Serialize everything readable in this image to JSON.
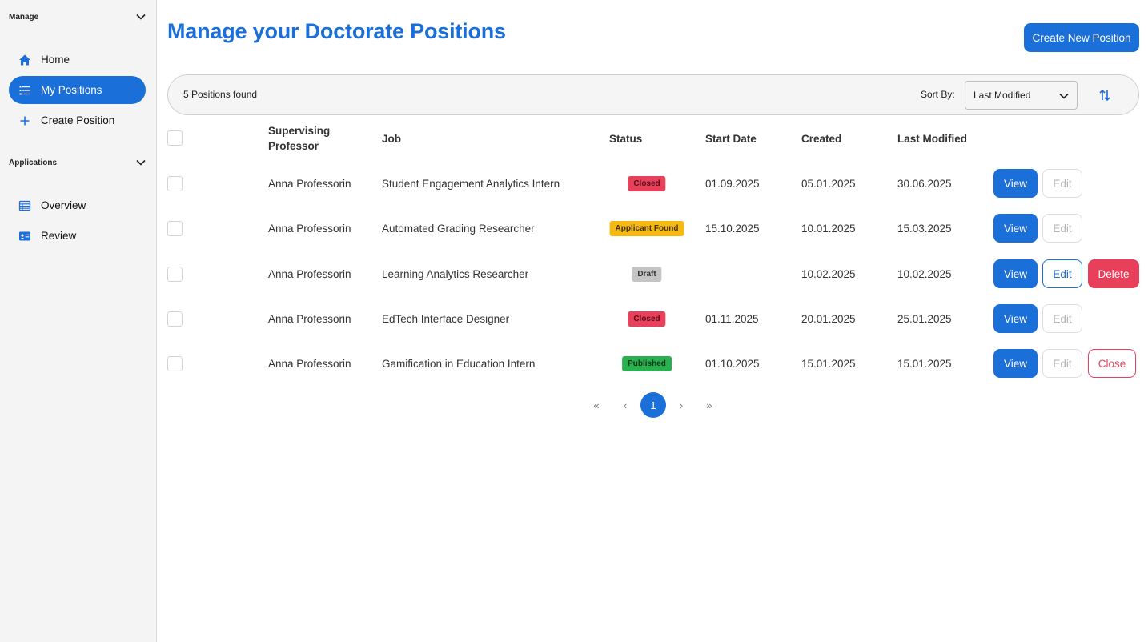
{
  "sidebar": {
    "manage_label": "Manage",
    "applications_label": "Applications",
    "manage_items": [
      {
        "label": "Home",
        "icon": "home-icon"
      },
      {
        "label": "My Positions",
        "icon": "list-icon",
        "active": true
      },
      {
        "label": "Create Position",
        "icon": "plus-icon"
      }
    ],
    "application_items": [
      {
        "label": "Overview",
        "icon": "table-icon"
      },
      {
        "label": "Review",
        "icon": "id-card-icon"
      }
    ]
  },
  "header": {
    "title": "Manage your Doctorate Positions",
    "create_button": "Create New Position"
  },
  "toolbar": {
    "found": "5 Positions found",
    "sort_label": "Sort By:",
    "sort_value": "Last Modified",
    "sort_icon": "sort-toggle-icon"
  },
  "table": {
    "headers": {
      "professor_line1": "Supervising",
      "professor_line2": "Professor",
      "job": "Job",
      "status": "Status",
      "start": "Start Date",
      "created": "Created",
      "modified": "Last Modified"
    },
    "rows": [
      {
        "professor": "Anna Professorin",
        "job": "Student Engagement Analytics Intern",
        "status": "Closed",
        "start": "01.09.2025",
        "created": "05.01.2025",
        "modified": "30.06.2025",
        "view": "View",
        "edit": "Edit",
        "extra": ""
      },
      {
        "professor": "Anna Professorin",
        "job": "Automated Grading Researcher",
        "status": "Applicant Found",
        "start": "15.10.2025",
        "created": "10.01.2025",
        "modified": "15.03.2025",
        "view": "View",
        "edit": "Edit",
        "extra": ""
      },
      {
        "professor": "Anna Professorin",
        "job": "Learning Analytics Researcher",
        "status": "Draft",
        "start": "",
        "created": "10.02.2025",
        "modified": "10.02.2025",
        "view": "View",
        "edit": "Edit",
        "extra": "Delete"
      },
      {
        "professor": "Anna Professorin",
        "job": "EdTech Interface Designer",
        "status": "Closed",
        "start": "01.11.2025",
        "created": "20.01.2025",
        "modified": "25.01.2025",
        "view": "View",
        "edit": "Edit",
        "extra": ""
      },
      {
        "professor": "Anna Professorin",
        "job": "Gamification in Education Intern",
        "status": "Published",
        "start": "01.10.2025",
        "created": "15.01.2025",
        "modified": "15.01.2025",
        "view": "View",
        "edit": "Edit",
        "extra": "Close"
      }
    ]
  },
  "pagination": {
    "first": "«",
    "prev": "‹",
    "current": "1",
    "next": "›",
    "last": "»"
  },
  "colors": {
    "accent": "#1b6fd9",
    "closed": "#e8405a",
    "applicant_found": "#f5b914",
    "draft": "#c4c4c4",
    "published": "#2bb04f"
  }
}
